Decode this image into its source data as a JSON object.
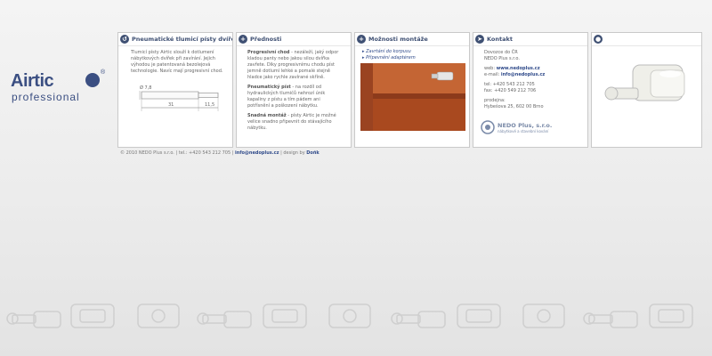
{
  "logo": {
    "brand": "Airtic",
    "sub": "professional",
    "registered": "®"
  },
  "panels": {
    "p1": {
      "title": "Pneumatické tlumicí písty dvířek",
      "text": "Tlumicí písty Airtic slouží k dotlumení nábytkových dvířek při zavírání. Jejich výhodou je patentovaná bezolejová technologie. Navíc mají progresivní chod.",
      "dim_diameter": "Ø 7,8",
      "dim_length": "31",
      "dim_tip": "11,5"
    },
    "p2": {
      "title": "Přednosti",
      "items": [
        {
          "head": "Progresivní chod",
          "text": " - nezáleží, jaký odpor kladou panty nebo jakou silou dvířka zavřete. Díky progresivnímu chodu píst jemně dotlumí lehké a pomalé stejně hladce jako rychle zavírané skříně."
        },
        {
          "head": "Pneumatický píst",
          "text": " - na rozdíl od hydraulických tlumičů nehrozí únik kapaliny z pístu a tím pádem ani potřísnění a poškození nábytku."
        },
        {
          "head": "Snadná montáž",
          "text": " - písty Airtic je možné velice snadno připevnit do stávajícího nábytku."
        }
      ]
    },
    "p3": {
      "title": "Možnosti montáže",
      "links": [
        "Zavrtání do korpusu",
        "Připevnění adaptérem"
      ]
    },
    "p4": {
      "title": "Kontakt",
      "address": [
        "Dovozce do ČR",
        "NEDO Plus s.r.o."
      ],
      "web_label": "web:",
      "web": "www.nedoplus.cz",
      "email_label": "e-mail:",
      "email": "info@nedoplus.cz",
      "tel_label": "tel:",
      "tel": "+420 543 212 705",
      "fax_label": "fax:",
      "fax": "+420 549 212 706",
      "shop_label": "prodejna:",
      "shop": "Hybešova 25, 602 00 Brno",
      "company_logo": "NEDO Plus, s.r.o.",
      "company_sub": "nábytkové a stavební kování"
    },
    "p5": {
      "title": ""
    }
  },
  "footer": {
    "copy": "© 2010 NEDO Plus s.r.o. | tel.: +420 543 212 705 | ",
    "email": "info@nedoplus.cz",
    "mid": " | design by ",
    "designer": "Doñk"
  },
  "colors": {
    "brand": "#3b4f82",
    "header_icon": "#3f5073",
    "link": "#2f4a8a",
    "wood": "#b5542a"
  },
  "icons": {
    "p1": "arrow-circle-icon",
    "p2": "plus-circle-icon",
    "p3": "plus-circle-icon",
    "p4": "send-arrow-icon",
    "p5": "globe-icon"
  }
}
